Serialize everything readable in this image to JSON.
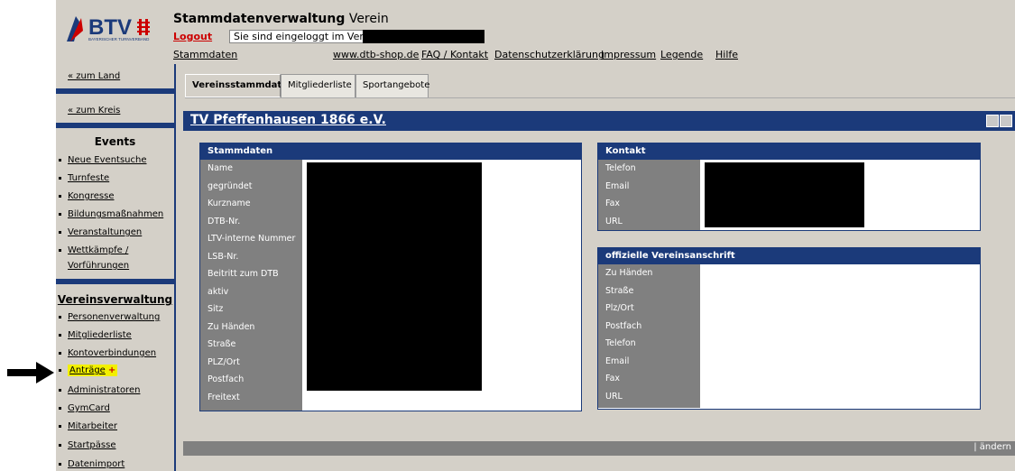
{
  "header": {
    "logo_text": "BTV",
    "logo_subtitle": "BAYERISCHER TURNVERBAND",
    "title_bold": "Stammdatenverwaltung",
    "title_rest": " Verein",
    "logout": "Logout",
    "login_info": "Sie sind eingeloggt im Verein",
    "nav": {
      "stammdaten": "Stammdaten",
      "shop": "www.dtb-shop.de",
      "faq": "FAQ / Kontakt",
      "datenschutz": "Datenschutzerklärung",
      "impressum": "Impressum",
      "legende": "Legende",
      "hilfe": "Hilfe"
    }
  },
  "sidebar": {
    "zum_land": "« zum Land",
    "zum_kreis": "« zum Kreis",
    "events_heading": "Events",
    "events": [
      "Neue Eventsuche",
      "Turnfeste",
      "Kongresse",
      "Bildungsmaßnahmen",
      "Veranstaltungen",
      "Wettkämpfe /",
      "Vorführungen"
    ],
    "verein_heading": "Vereinsverwaltung",
    "verein": [
      "Personenverwaltung",
      "Mitgliederliste",
      "Kontoverbindungen",
      "Anträge",
      "Administratoren",
      "GymCard",
      "Mitarbeiter",
      "Startpässe",
      "Datenimport"
    ],
    "plus_symbol": "+"
  },
  "tabs": [
    "Vereinsstammdaten",
    "Mitgliederliste",
    "Sportangebote"
  ],
  "club_name": "TV Pfeffenhausen 1866 e.V.",
  "stammdaten": {
    "title": "Stammdaten",
    "labels": [
      "Name",
      "gegründet",
      "Kurzname",
      "DTB-Nr.",
      "LTV-interne Nummer",
      "LSB-Nr.",
      "Beitritt zum DTB",
      "aktiv",
      "Sitz",
      "Zu Händen",
      "Straße",
      "PLZ/Ort",
      "Postfach",
      "Freitext"
    ]
  },
  "kontakt": {
    "title": "Kontakt",
    "labels": [
      "Telefon",
      "Email",
      "Fax",
      "URL"
    ]
  },
  "anschrift": {
    "title": "offizielle Vereinsanschrift",
    "labels": [
      "Zu Händen",
      "Straße",
      "Plz/Ort",
      "Postfach",
      "Telefon",
      "Email",
      "Fax",
      "URL"
    ]
  },
  "footer": {
    "edit": "| ändern"
  },
  "colors": {
    "navy": "#1b3a7a",
    "panel_gray": "#d4d0c8",
    "label_gray": "#808080",
    "highlight": "#f2f000",
    "logout_red": "#cc0000"
  },
  "icons": {
    "pointer": "arrow-right-icon",
    "logo": "btv-logo-icon"
  }
}
